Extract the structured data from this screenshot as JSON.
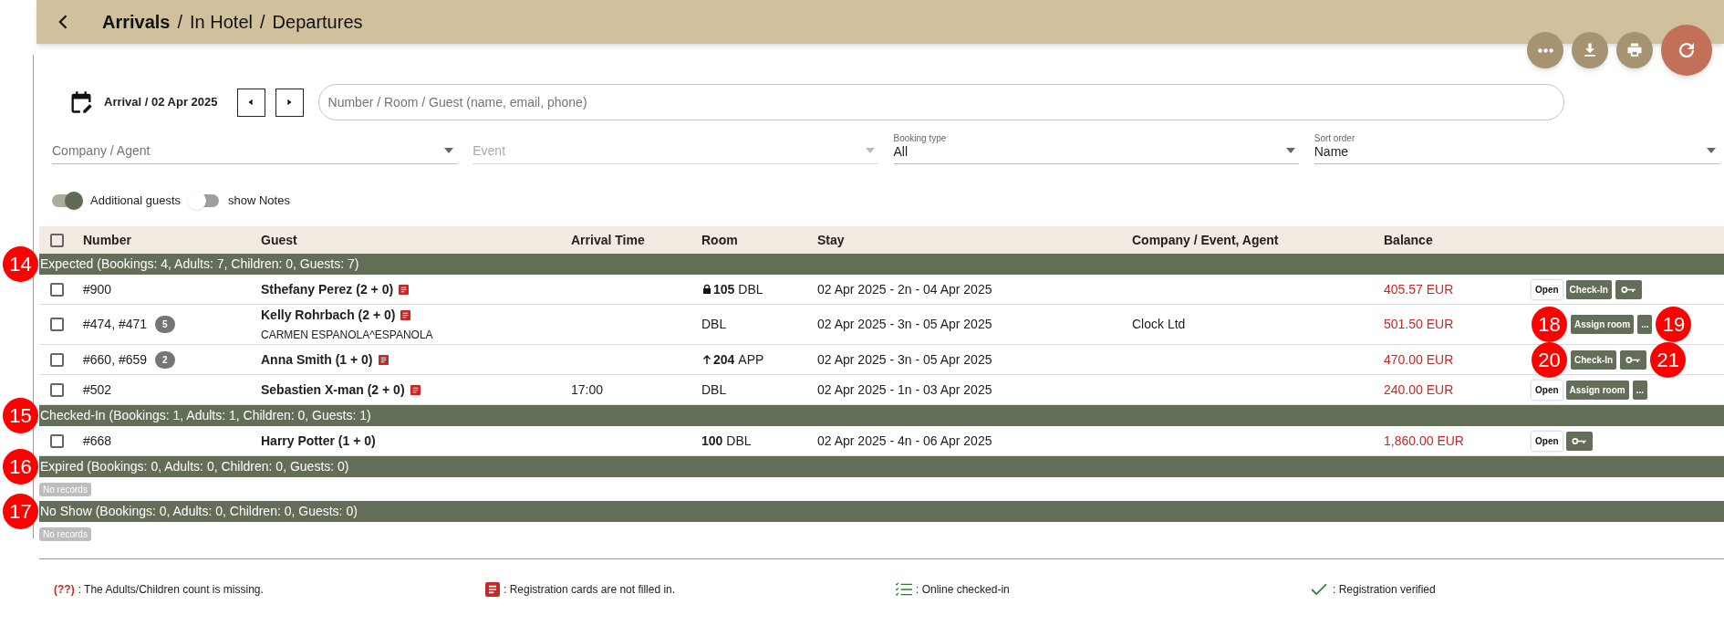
{
  "header": {
    "title_parts": [
      {
        "text": "Arrivals",
        "selected": true
      },
      {
        "text": "In Hotel",
        "selected": false
      },
      {
        "text": "Departures",
        "selected": false
      }
    ],
    "separator": "/"
  },
  "fab_buttons": [
    {
      "kind": "more"
    },
    {
      "kind": "download"
    },
    {
      "kind": "print"
    },
    {
      "kind": "refresh"
    }
  ],
  "date_label": "Arrival / 02 Apr 2025",
  "search": {
    "placeholder": "Number / Room / Guest (name, email, phone)"
  },
  "filters": [
    {
      "label": "Company / Agent",
      "disabled": false
    },
    {
      "label": "Event",
      "disabled": true
    },
    {
      "label": "Booking type",
      "value": "All",
      "disabled": false
    },
    {
      "label": "Sort order",
      "value": "Name",
      "disabled": false
    }
  ],
  "toggles": [
    {
      "label": "Additional guests",
      "on": true
    },
    {
      "label": "show Notes",
      "on": false
    }
  ],
  "table": {
    "select_all_checked": false,
    "columns": [
      "Number",
      "Guest",
      "Arrival Time",
      "Room",
      "Stay",
      "Company / Event, Agent",
      "Balance"
    ],
    "groups": [
      {
        "title": "Expected (Bookings: 4, Adults: 7, Children: 0, Guests: 7)",
        "marker": "14",
        "rows": [
          {
            "checked": false,
            "number": "#900",
            "guest": "Sthefany Perez (2 + 0)",
            "card_missing": true,
            "room": {
              "kind": "locked",
              "number": "105",
              "type": "DBL"
            },
            "stay": "02 Apr 2025 - 2n - 04 Apr 2025",
            "balance": "405.57 EUR",
            "actions": [
              {
                "kind": "open",
                "label": "Open"
              },
              {
                "kind": "checkin",
                "label": "Check-In"
              },
              {
                "kind": "key"
              }
            ]
          },
          {
            "checked": false,
            "number": "#474, #471",
            "count": "5",
            "guest": "Kelly Rohrbach (2 + 0)",
            "card_missing": true,
            "subname": "CARMEN ESPANOLA^ESPANOLA",
            "room": {
              "kind": "plain",
              "type": "DBL"
            },
            "stay": "02 Apr 2025 - 3n - 05 Apr 2025",
            "company": "Clock Ltd",
            "balance": "501.50 EUR",
            "actions": [
              {
                "kind": "marker",
                "label": "18"
              },
              {
                "kind": "assign",
                "label": "Assign room"
              },
              {
                "kind": "more",
                "label": "..."
              },
              {
                "kind": "marker",
                "label": "19"
              }
            ]
          },
          {
            "checked": false,
            "number": "#660, #659",
            "count": "2",
            "guest": "Anna Smith (1 + 0)",
            "card_missing": true,
            "room": {
              "kind": "upgraded",
              "number": "204",
              "type": "APP"
            },
            "stay": "02 Apr 2025 - 3n - 05 Apr 2025",
            "balance": "470.00 EUR",
            "actions": [
              {
                "kind": "marker",
                "label": "20"
              },
              {
                "kind": "checkin",
                "label": "Check-In"
              },
              {
                "kind": "key"
              },
              {
                "kind": "marker",
                "label": "21"
              }
            ]
          },
          {
            "checked": false,
            "number": "#502",
            "guest": "Sebastien X-man (2 + 0)",
            "card_missing": true,
            "arrival_time": "17:00",
            "room": {
              "kind": "plain",
              "type": "DBL"
            },
            "stay": "02 Apr 2025 - 1n - 03 Apr 2025",
            "balance": "240.00 EUR",
            "actions": [
              {
                "kind": "open",
                "label": "Open"
              },
              {
                "kind": "assign",
                "label": "Assign room"
              },
              {
                "kind": "more",
                "label": "..."
              }
            ]
          }
        ]
      },
      {
        "title": "Checked-In (Bookings: 1, Adults: 1, Children: 0, Guests: 1)",
        "marker": "15",
        "rows": [
          {
            "checked": false,
            "number": "#668",
            "guest": "Harry Potter (1 + 0)",
            "card_missing": false,
            "room": {
              "kind": "plain",
              "number": "100",
              "type": "DBL"
            },
            "stay": "02 Apr 2025 - 4n - 06 Apr 2025",
            "balance": "1,860.00 EUR",
            "actions": [
              {
                "kind": "open",
                "label": "Open"
              },
              {
                "kind": "key"
              }
            ]
          }
        ]
      },
      {
        "title": "Expired (Bookings: 0, Adults: 0, Children: 0, Guests: 0)",
        "marker": "16",
        "empty": "No records"
      },
      {
        "title": "No Show (Bookings: 0, Adults: 0, Children: 0, Guests: 0)",
        "marker": "17",
        "empty": "No records"
      }
    ]
  },
  "legend": [
    {
      "kind": "missing",
      "symbol": "(??)",
      "text": ": The Adults/Children count is missing."
    },
    {
      "kind": "card",
      "text": ": Registration cards are not filled in."
    },
    {
      "kind": "online",
      "text": ": Online checked-in"
    },
    {
      "kind": "verified",
      "text": ": Registration verified"
    }
  ]
}
